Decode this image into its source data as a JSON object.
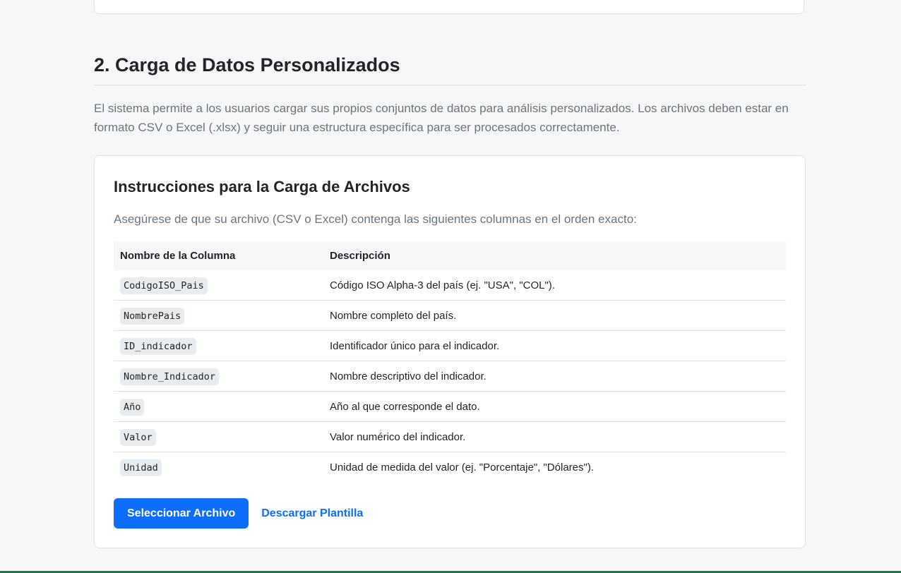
{
  "section": {
    "title": "2. Carga de Datos Personalizados",
    "intro": "El sistema permite a los usuarios cargar sus propios conjuntos de datos para análisis personalizados. Los archivos deben estar en formato CSV o Excel (.xlsx) y seguir una estructura específica para ser procesados correctamente."
  },
  "card": {
    "title": "Instrucciones para la Carga de Archivos",
    "description": "Asegúrese de que su archivo (CSV o Excel) contenga las siguientes columnas en el orden exacto:",
    "table": {
      "headers": [
        "Nombre de la Columna",
        "Descripción"
      ],
      "rows": [
        {
          "column": "CodigoISO_Pais",
          "description": "Código ISO Alpha-3 del país (ej. \"USA\", \"COL\")."
        },
        {
          "column": "NombrePais",
          "description": "Nombre completo del país."
        },
        {
          "column": "ID_indicador",
          "description": "Identificador único para el indicador."
        },
        {
          "column": "Nombre_Indicador",
          "description": "Nombre descriptivo del indicador."
        },
        {
          "column": "Año",
          "description": "Año al que corresponde el dato."
        },
        {
          "column": "Valor",
          "description": "Valor numérico del indicador."
        },
        {
          "column": "Unidad",
          "description": "Unidad de medida del valor (ej. \"Porcentaje\", \"Dólares\")."
        }
      ]
    },
    "actions": {
      "select_button": "Seleccionar Archivo",
      "download_link": "Descargar Plantilla"
    }
  },
  "colors": {
    "primary": "#0d6efd",
    "background": "#f6f7f9",
    "border": "#dee2e6",
    "muted_text": "#6c757d"
  }
}
